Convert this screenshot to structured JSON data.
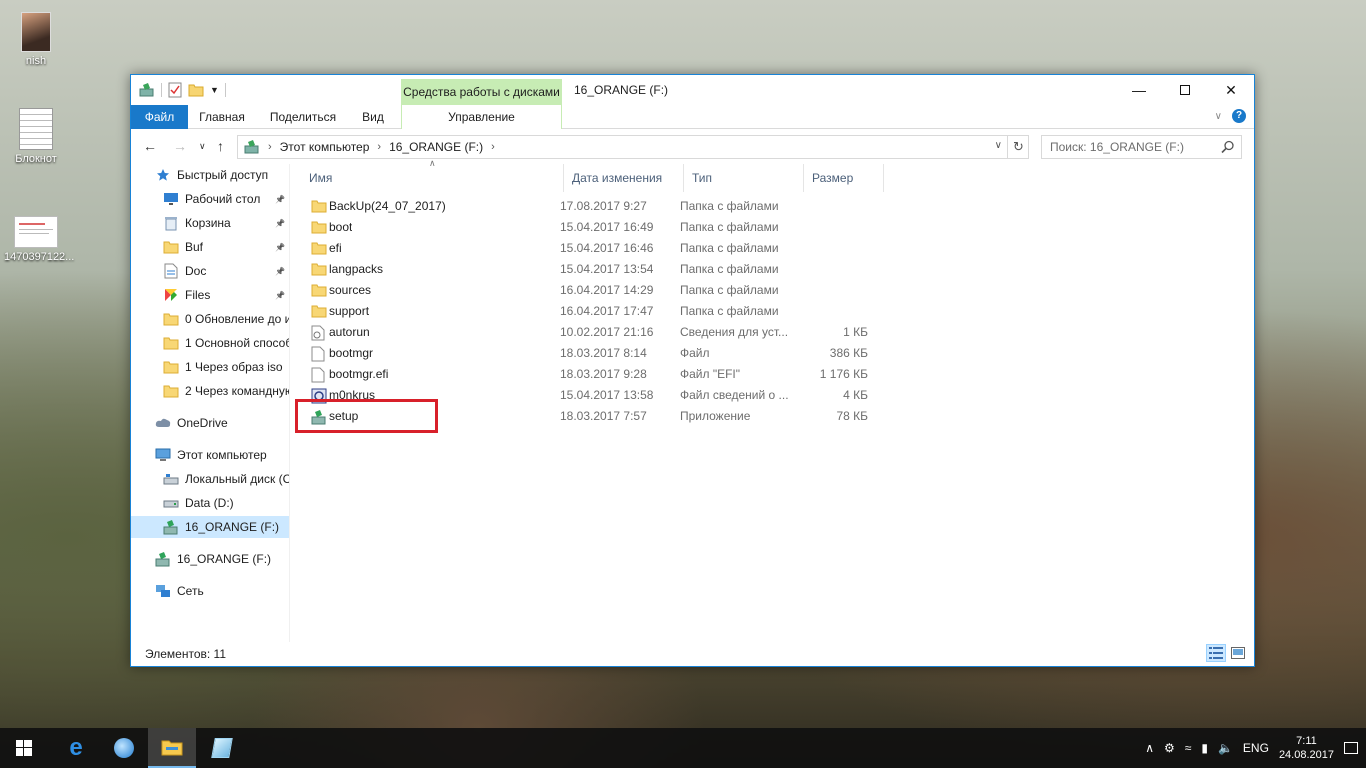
{
  "desktop": {
    "icons": [
      {
        "label": "nish",
        "icon": "user-photo-icon"
      },
      {
        "label": "Блокнот",
        "icon": "notepad-icon"
      },
      {
        "label": "1470397122...",
        "icon": "image-file-icon"
      }
    ]
  },
  "window": {
    "title": "16_ORANGE (F:)",
    "context_tab_group": "Средства работы с дисками",
    "ribbon_tabs": [
      "Файл",
      "Главная",
      "Поделиться",
      "Вид",
      "Управление"
    ],
    "address": {
      "root_icon": "drive-icon",
      "segments": [
        "Этот компьютер",
        "16_ORANGE (F:)"
      ]
    },
    "search": {
      "placeholder": "Поиск: 16_ORANGE (F:)"
    },
    "columns": [
      "Имя",
      "Дата изменения",
      "Тип",
      "Размер"
    ],
    "files": [
      {
        "name": "BackUp(24_07_2017)",
        "date": "17.08.2017 9:27",
        "type": "Папка с файлами",
        "size": "",
        "icon": "folder-icon"
      },
      {
        "name": "boot",
        "date": "15.04.2017 16:49",
        "type": "Папка с файлами",
        "size": "",
        "icon": "folder-icon"
      },
      {
        "name": "efi",
        "date": "15.04.2017 16:46",
        "type": "Папка с файлами",
        "size": "",
        "icon": "folder-icon"
      },
      {
        "name": "langpacks",
        "date": "15.04.2017 13:54",
        "type": "Папка с файлами",
        "size": "",
        "icon": "folder-icon"
      },
      {
        "name": "sources",
        "date": "16.04.2017 14:29",
        "type": "Папка с файлами",
        "size": "",
        "icon": "folder-icon"
      },
      {
        "name": "support",
        "date": "16.04.2017 17:47",
        "type": "Папка с файлами",
        "size": "",
        "icon": "folder-icon"
      },
      {
        "name": "autorun",
        "date": "10.02.2017 21:16",
        "type": "Сведения для уст...",
        "size": "1 КБ",
        "icon": "settings-file-icon"
      },
      {
        "name": "bootmgr",
        "date": "18.03.2017 8:14",
        "type": "Файл",
        "size": "386 КБ",
        "icon": "file-icon"
      },
      {
        "name": "bootmgr.efi",
        "date": "18.03.2017 9:28",
        "type": "Файл \"EFI\"",
        "size": "1 176 КБ",
        "icon": "file-icon"
      },
      {
        "name": "m0nkrus",
        "date": "15.04.2017 13:58",
        "type": "Файл сведений о ...",
        "size": "4 КБ",
        "icon": "info-file-icon"
      },
      {
        "name": "setup",
        "date": "18.03.2017 7:57",
        "type": "Приложение",
        "size": "78 КБ",
        "icon": "setup-app-icon"
      }
    ],
    "sidebar": [
      {
        "label": "Быстрый доступ",
        "icon": "star-icon",
        "level": 0,
        "pinned": false,
        "selected": false
      },
      {
        "label": "Рабочий стол",
        "icon": "desktop-icon",
        "level": 1,
        "pinned": true,
        "selected": false
      },
      {
        "label": "Корзина",
        "icon": "recycle-bin-icon",
        "level": 1,
        "pinned": true,
        "selected": false
      },
      {
        "label": "Buf",
        "icon": "folder-icon",
        "level": 1,
        "pinned": true,
        "selected": false
      },
      {
        "label": "Doc",
        "icon": "document-icon",
        "level": 1,
        "pinned": true,
        "selected": false
      },
      {
        "label": "Files",
        "icon": "files-icon",
        "level": 1,
        "pinned": true,
        "selected": false
      },
      {
        "label": "0 Обновление до и",
        "icon": "folder-icon",
        "level": 1,
        "pinned": false,
        "selected": false
      },
      {
        "label": "1 Основной способ",
        "icon": "folder-icon",
        "level": 1,
        "pinned": false,
        "selected": false
      },
      {
        "label": "1 Через образ iso",
        "icon": "folder-icon",
        "level": 1,
        "pinned": false,
        "selected": false
      },
      {
        "label": "2 Через командную",
        "icon": "folder-icon",
        "level": 1,
        "pinned": false,
        "selected": false
      },
      {
        "label": "OneDrive",
        "icon": "onedrive-icon",
        "level": 0,
        "pinned": false,
        "selected": false
      },
      {
        "label": "Этот компьютер",
        "icon": "computer-icon",
        "level": 0,
        "pinned": false,
        "selected": false
      },
      {
        "label": "Локальный диск (C",
        "icon": "local-disk-icon",
        "level": 1,
        "pinned": false,
        "selected": false
      },
      {
        "label": "Data (D:)",
        "icon": "disk-icon",
        "level": 1,
        "pinned": false,
        "selected": false
      },
      {
        "label": "16_ORANGE (F:)",
        "icon": "usb-drive-icon",
        "level": 1,
        "pinned": false,
        "selected": true
      },
      {
        "label": "16_ORANGE (F:)",
        "icon": "usb-drive-icon",
        "level": 0,
        "pinned": false,
        "selected": false
      },
      {
        "label": "Сеть",
        "icon": "network-icon",
        "level": 0,
        "pinned": false,
        "selected": false
      }
    ],
    "status": "Элементов: 11"
  },
  "taskbar": {
    "items": [
      "start-icon",
      "edge-icon",
      "browser-icon",
      "file-explorer-icon",
      "notepad-icon"
    ],
    "language": "ENG",
    "time": "7:11",
    "date": "24.08.2017"
  },
  "colors": {
    "accent": "#1979ca",
    "highlight": "#d8202a",
    "context_tab": "#c7ecb4",
    "selected": "#cce8ff"
  }
}
